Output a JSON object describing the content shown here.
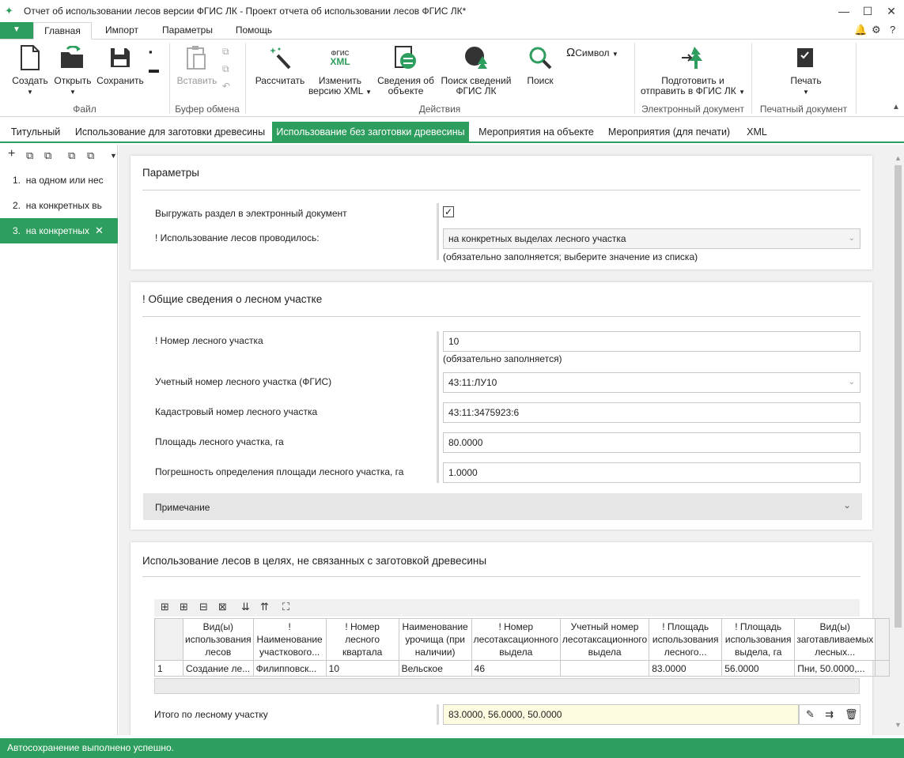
{
  "window": {
    "title": "Отчет об использовании лесов версии ФГИС ЛК - Проект отчета об использовании лесов ФГИС ЛК*"
  },
  "menu": {
    "file": "▼",
    "tabs": [
      "Главная",
      "Импорт",
      "Параметры",
      "Помощь"
    ]
  },
  "ribbon": {
    "create": "Создать",
    "open": "Открыть",
    "save": "Сохранить",
    "group_file": "Файл",
    "paste": "Вставить",
    "group_clipboard": "Буфер обмена",
    "calc": "Рассчитать",
    "change_xml_1": "Изменить",
    "change_xml_2": "версию XML",
    "fgis_xml_1": "ФГИС",
    "fgis_xml_2": "XML",
    "obj_info_1": "Сведения об",
    "obj_info_2": "объекте",
    "search_fgis_1": "Поиск сведений",
    "search_fgis_2": "ФГИС ЛК",
    "search": "Поиск",
    "symbol": "Символ",
    "group_actions": "Действия",
    "prepare_1": "Подготовить и",
    "prepare_2": "отправить в ФГИС ЛК",
    "group_edoc": "Электронный документ",
    "print": "Печать",
    "group_pdoc": "Печатный документ"
  },
  "doc_tabs": [
    "Титульный",
    "Использование для заготовки древесины",
    "Использование без заготовки древесины",
    "Мероприятия на объекте",
    "Мероприятия (для печати)",
    "XML"
  ],
  "sidebar": {
    "items": [
      {
        "num": "1.",
        "label": "на одном или нес"
      },
      {
        "num": "2.",
        "label": "на конкретных вь"
      },
      {
        "num": "3.",
        "label": "на конкретных"
      }
    ]
  },
  "params": {
    "title": "Параметры",
    "export_label": "Выгружать раздел в электронный документ",
    "usage_label": "! Использование лесов проводилось:",
    "usage_value": "на конкретных выделах лесного участка",
    "usage_hint": "(обязательно заполняется; выберите значение из списка)"
  },
  "general": {
    "title": "! Общие сведения о лесном участке",
    "num_label": "! Номер лесного участка",
    "num_value": "10",
    "num_hint": "(обязательно заполняется)",
    "acc_label": "Учетный номер лесного участка (ФГИС)",
    "acc_value": "43:11:ЛУ10",
    "cad_label": "Кадастровый номер лесного участка",
    "cad_value": "43:11:3475923:6",
    "area_label": "Площадь лесного участка, га",
    "area_value": "80.0000",
    "err_label": "Погрешность определения площади лесного участка, га",
    "err_value": "1.0000",
    "note_label": "Примечание"
  },
  "usage": {
    "title": "Использование лесов в целях, не связанных с заготовкой древесины",
    "columns": [
      "Вид(ы) использования лесов",
      "! Наименование участкового...",
      "! Номер лесного квартала",
      "Наименование урочища (при наличии)",
      "! Номер лесотаксационного выдела",
      "Учетный номер лесотаксационного выдела",
      "! Площадь использования лесного...",
      "! Площадь использования выдела, га",
      "Вид(ы) заготавливаемых лесных..."
    ],
    "rows": [
      {
        "n": "1",
        "cells": [
          "Создание ле...",
          "Филипповск...",
          "10",
          "Вельское",
          "46",
          "",
          "83.0000",
          "56.0000",
          "Пни, 50.0000,..."
        ]
      }
    ],
    "total_label": "Итого по лесному участку",
    "total_value": "83.0000, 56.0000, 50.0000"
  },
  "status": {
    "text": "Автосохранение выполнено успешно."
  }
}
